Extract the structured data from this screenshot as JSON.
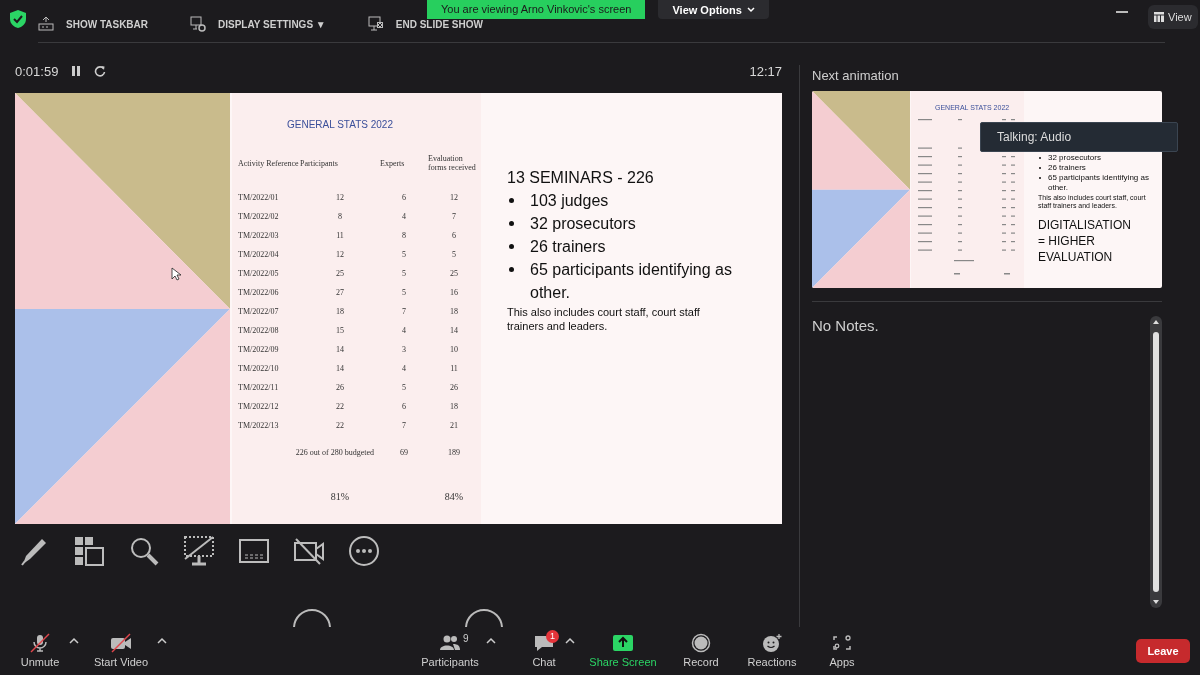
{
  "top_bar": {
    "items": [
      {
        "kind": "taskbar",
        "label": "SHOW TASKBAR"
      },
      {
        "kind": "display",
        "label": "DISPLAY SETTINGS ▼"
      },
      {
        "kind": "end",
        "label": "END SLIDE SHOW"
      }
    ]
  },
  "share_banner": {
    "text": "You are viewing Arno Vinkovic's screen",
    "options": "View Options"
  },
  "view_button": {
    "label": "View"
  },
  "presenter": {
    "elapsed": "0:01:59",
    "clock": "12:17"
  },
  "slide": {
    "table": {
      "title": "GENERAL STATS 2022",
      "columns": [
        "Activity Reference",
        "Participants",
        "Experts",
        "Evaluation forms received"
      ],
      "rows": [
        [
          "TM/2022/01",
          "12",
          "6",
          "12"
        ],
        [
          "TM/2022/02",
          "8",
          "4",
          "7"
        ],
        [
          "TM/2022/03",
          "11",
          "8",
          "6"
        ],
        [
          "TM/2022/04",
          "12",
          "5",
          "5"
        ],
        [
          "TM/2022/05",
          "25",
          "5",
          "25"
        ],
        [
          "TM/2022/06",
          "27",
          "5",
          "16"
        ],
        [
          "TM/2022/07",
          "18",
          "7",
          "18"
        ],
        [
          "TM/2022/08",
          "15",
          "4",
          "14"
        ],
        [
          "TM/2022/09",
          "14",
          "3",
          "10"
        ],
        [
          "TM/2022/10",
          "14",
          "4",
          "11"
        ],
        [
          "TM/2022/11",
          "26",
          "5",
          "26"
        ],
        [
          "TM/2022/12",
          "22",
          "6",
          "18"
        ],
        [
          "TM/2022/13",
          "22",
          "7",
          "21"
        ]
      ],
      "total": [
        "226 out of 280 budgeted",
        "69",
        "189"
      ],
      "percentages": [
        "81%",
        "84%"
      ]
    },
    "heading": "13 SEMINARS - 226",
    "bullets": [
      "103 judges",
      "32 prosecutors",
      "26 trainers",
      "65 participants identifying as other."
    ],
    "note": "This also includes court staff, court staff trainers and leaders."
  },
  "next_panel": {
    "title": "Next animation",
    "thumbnail": {
      "title": "GENERAL STATS 2022",
      "bullets": [
        "32 prosecutors",
        "26 trainers",
        "65 participants identifying as other."
      ],
      "note": "This also includes court staff, court staff trainers and leaders.",
      "heading": "DIGITALISATION = HIGHER EVALUATION"
    },
    "tooltip": "Talking: Audio",
    "notes": "No Notes."
  },
  "toolbar": {
    "items": [
      {
        "kind": "mic",
        "label": "Unmute",
        "muted": true,
        "caret": true
      },
      {
        "kind": "video",
        "label": "Start Video",
        "muted": true,
        "caret": true
      },
      {
        "kind": "participants",
        "label": "Participants",
        "count": "9",
        "caret": true
      },
      {
        "kind": "chat",
        "label": "Chat",
        "badge": "1",
        "caret": true
      },
      {
        "kind": "share",
        "label": "Share Screen"
      },
      {
        "kind": "record",
        "label": "Record"
      },
      {
        "kind": "reactions",
        "label": "Reactions"
      },
      {
        "kind": "apps",
        "label": "Apps"
      }
    ],
    "leave": "Leave"
  }
}
